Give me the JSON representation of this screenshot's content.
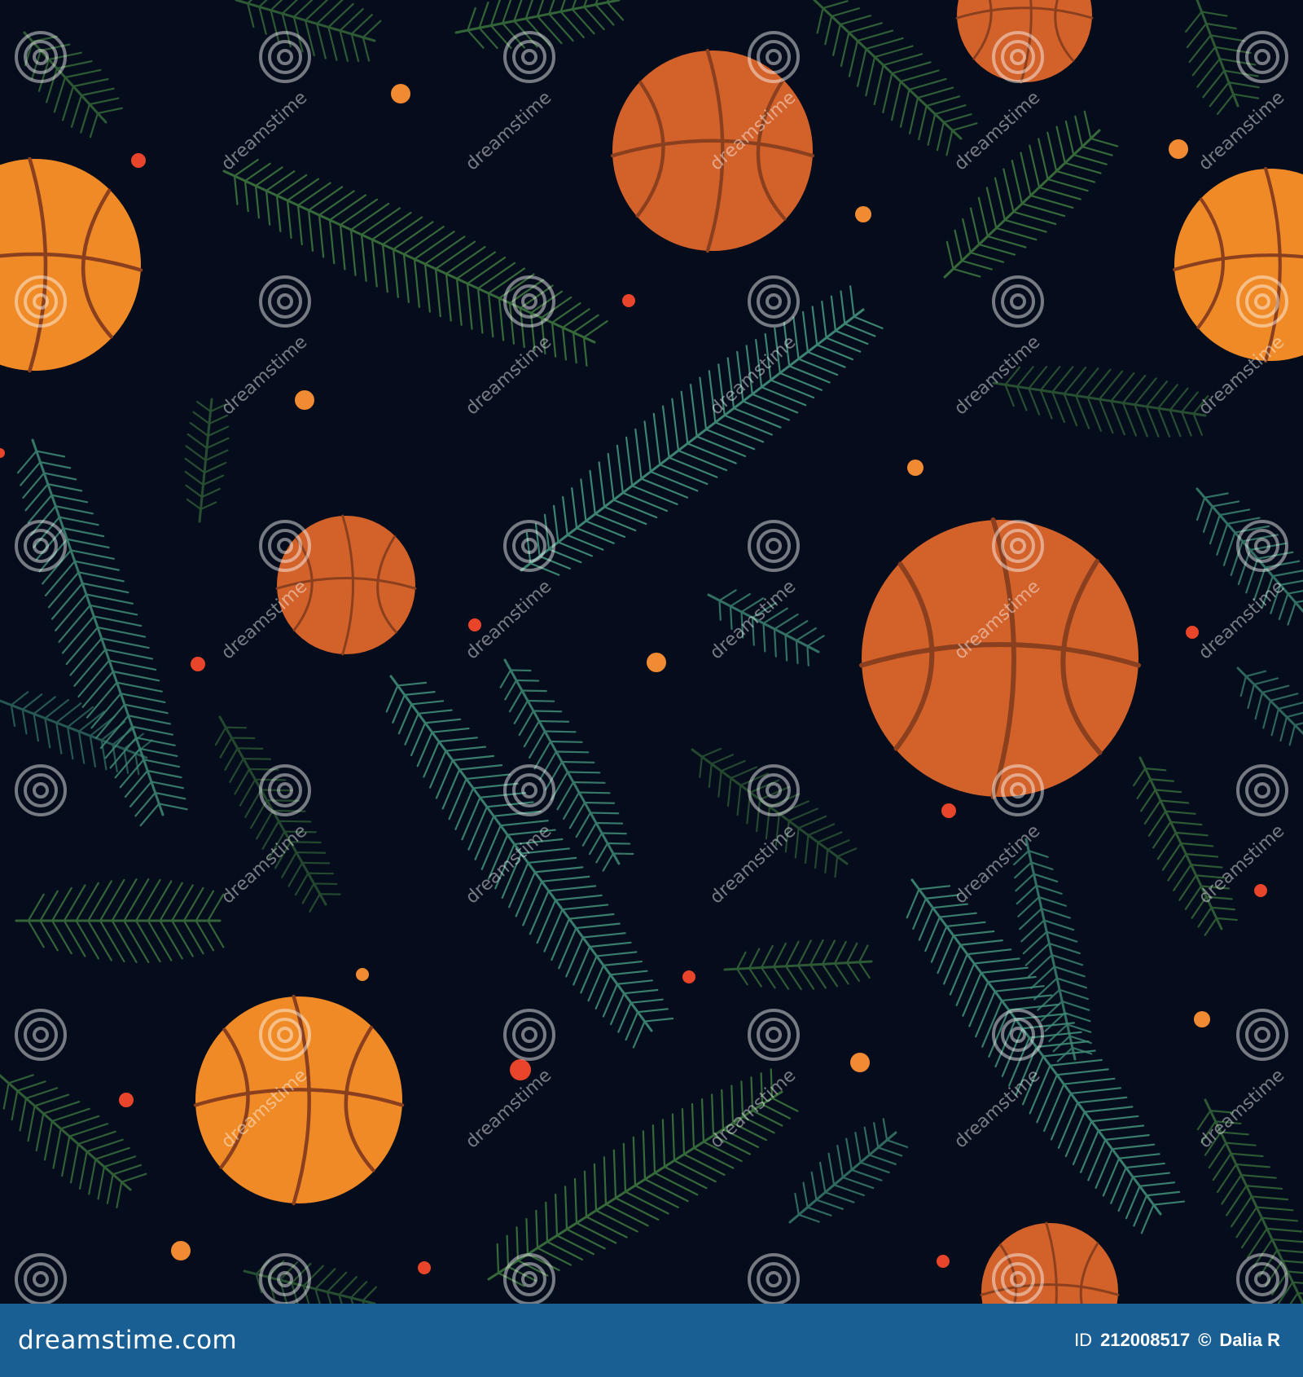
{
  "colors": {
    "background": "#050c1c",
    "footer": "#1a5f94",
    "ball_light": "#ef8a26",
    "ball_dark": "#d2612a",
    "seam": "#8a3f1e",
    "branch_green": "#3f7a3f",
    "branch_teal": "#3f8a76",
    "berry_red": "#e8452a",
    "berry_orange": "#f08a33"
  },
  "pattern": {
    "icon": "basketball-icon",
    "branch_icon": "fir-branch-icon",
    "berry_icon": "berry-dot-icon",
    "watermark_icon": "spiral-watermark-icon"
  },
  "watermark": {
    "text": "dreamstime"
  },
  "footer": {
    "brand": "dreamstime.com",
    "id_label": "ID",
    "id_value": "212008517",
    "copyright": "©",
    "author": "Dalia R"
  }
}
